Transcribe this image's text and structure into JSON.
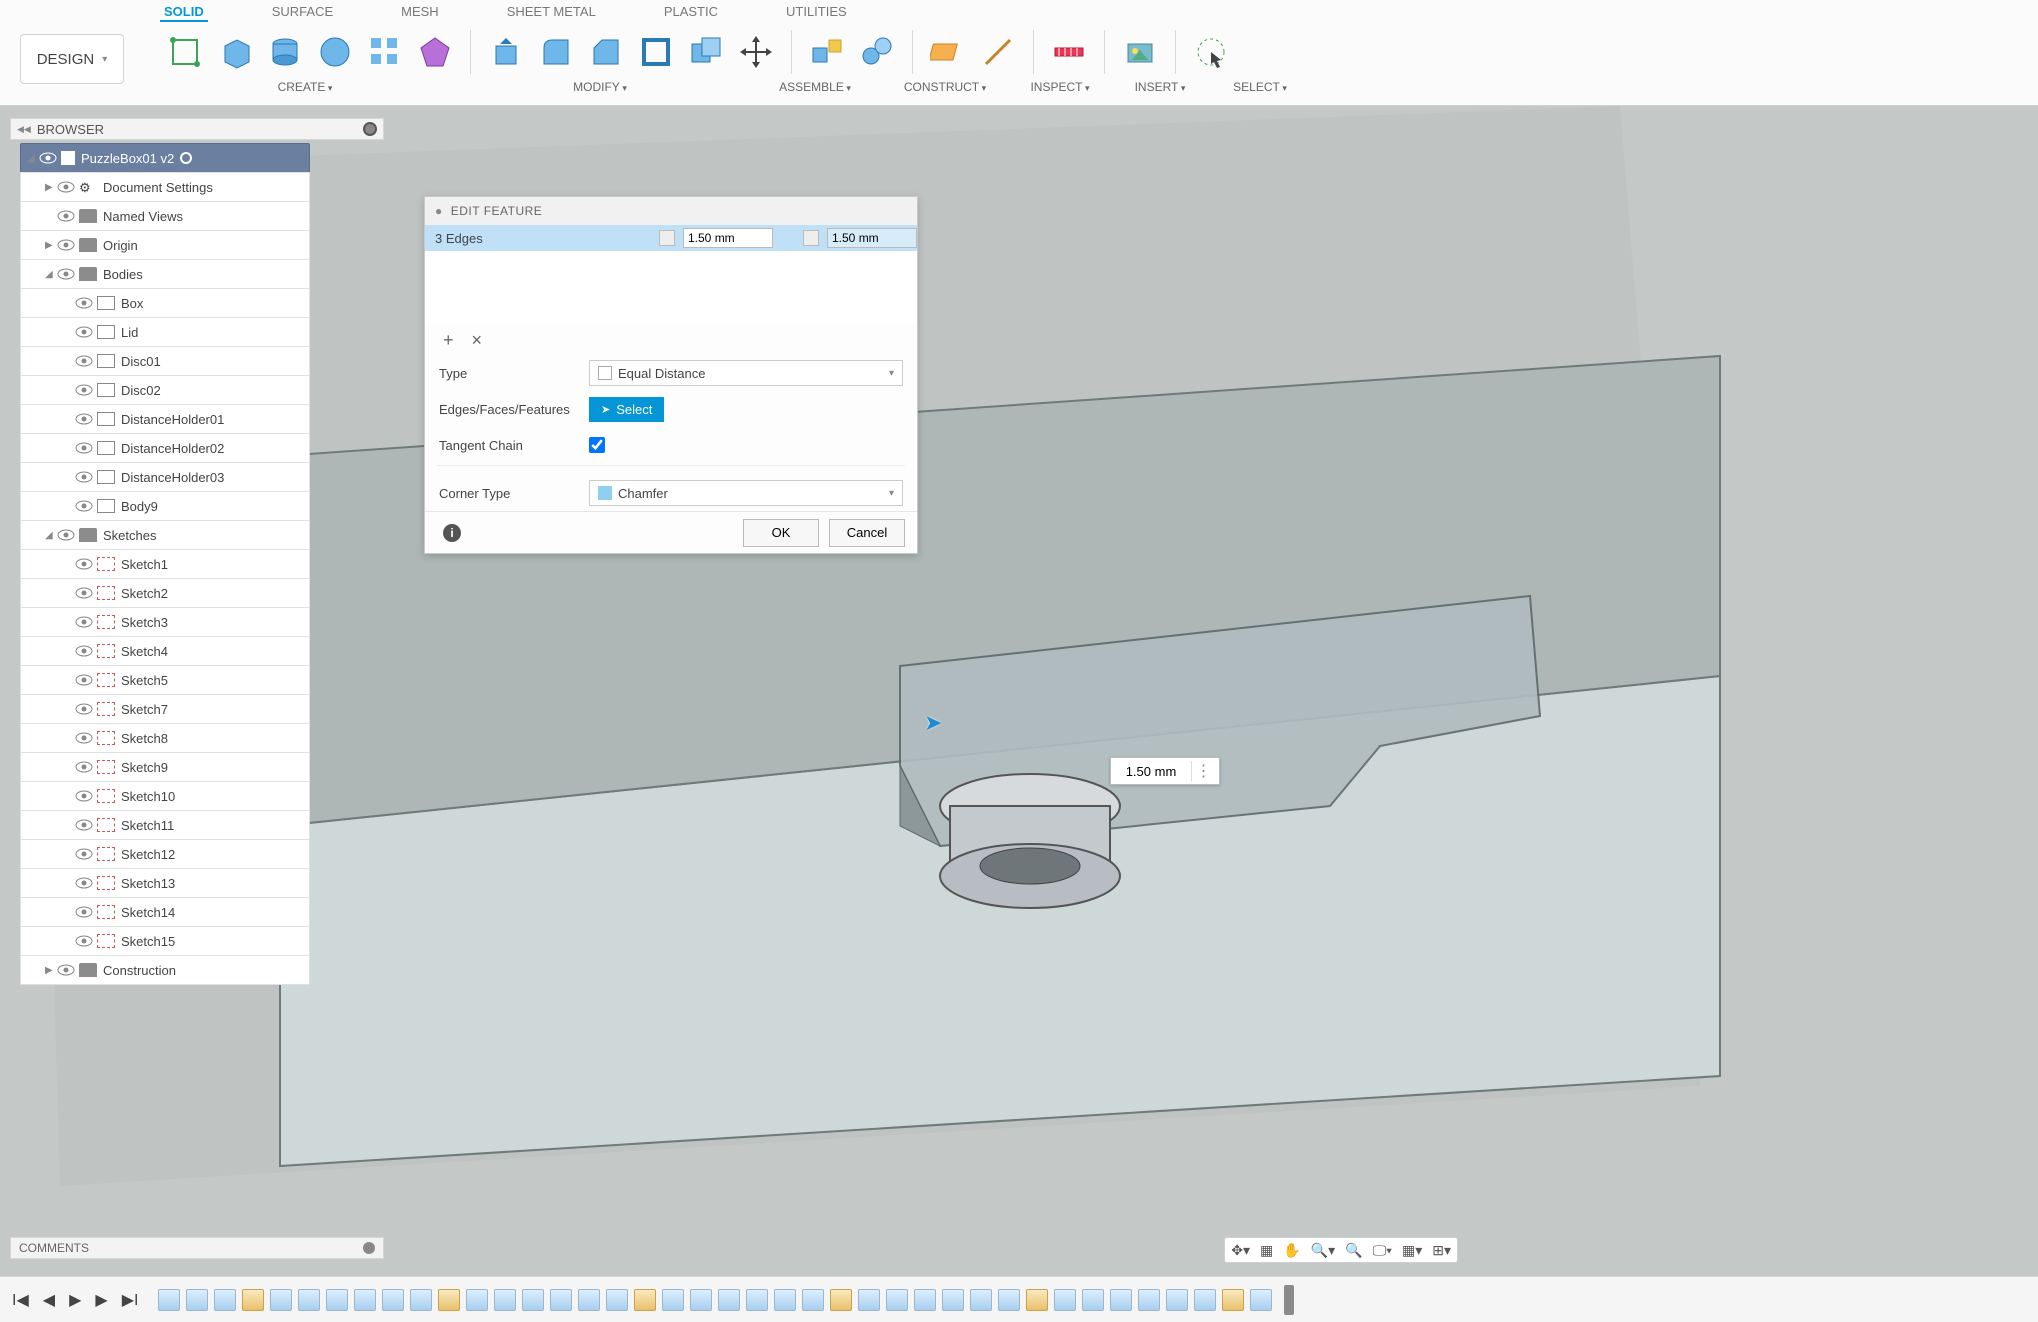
{
  "workspace": {
    "label": "DESIGN"
  },
  "tabs": [
    "SOLID",
    "SURFACE",
    "MESH",
    "SHEET METAL",
    "PLASTIC",
    "UTILITIES"
  ],
  "active_tab": "SOLID",
  "groups": {
    "create": "CREATE",
    "modify": "MODIFY",
    "assemble": "ASSEMBLE",
    "construct": "CONSTRUCT",
    "inspect": "INSPECT",
    "insert": "INSERT",
    "select": "SELECT"
  },
  "browser": {
    "title": "BROWSER",
    "root": "PuzzleBox01 v2",
    "items": [
      {
        "label": "Document Settings",
        "icon": "gear",
        "indent": 1,
        "tri": "▶"
      },
      {
        "label": "Named Views",
        "icon": "folder",
        "indent": 1,
        "tri": ""
      },
      {
        "label": "Origin",
        "icon": "folder",
        "indent": 1,
        "tri": "▶"
      },
      {
        "label": "Bodies",
        "icon": "folder",
        "indent": 1,
        "tri": "◢"
      },
      {
        "label": "Box",
        "icon": "body",
        "indent": 2
      },
      {
        "label": "Lid",
        "icon": "body",
        "indent": 2
      },
      {
        "label": "Disc01",
        "icon": "body",
        "indent": 2
      },
      {
        "label": "Disc02",
        "icon": "body",
        "indent": 2
      },
      {
        "label": "DistanceHolder01",
        "icon": "body",
        "indent": 2
      },
      {
        "label": "DistanceHolder02",
        "icon": "body",
        "indent": 2
      },
      {
        "label": "DistanceHolder03",
        "icon": "body",
        "indent": 2
      },
      {
        "label": "Body9",
        "icon": "body",
        "indent": 2
      },
      {
        "label": "Sketches",
        "icon": "folder",
        "indent": 1,
        "tri": "◢"
      },
      {
        "label": "Sketch1",
        "icon": "sketch",
        "indent": 2
      },
      {
        "label": "Sketch2",
        "icon": "sketch",
        "indent": 2
      },
      {
        "label": "Sketch3",
        "icon": "sketch",
        "indent": 2
      },
      {
        "label": "Sketch4",
        "icon": "sketch",
        "indent": 2
      },
      {
        "label": "Sketch5",
        "icon": "sketch",
        "indent": 2
      },
      {
        "label": "Sketch7",
        "icon": "sketch",
        "indent": 2
      },
      {
        "label": "Sketch8",
        "icon": "sketch",
        "indent": 2
      },
      {
        "label": "Sketch9",
        "icon": "sketch",
        "indent": 2
      },
      {
        "label": "Sketch10",
        "icon": "sketch",
        "indent": 2
      },
      {
        "label": "Sketch11",
        "icon": "sketch",
        "indent": 2
      },
      {
        "label": "Sketch12",
        "icon": "sketch",
        "indent": 2
      },
      {
        "label": "Sketch13",
        "icon": "sketch",
        "indent": 2
      },
      {
        "label": "Sketch14",
        "icon": "sketch",
        "indent": 2
      },
      {
        "label": "Sketch15",
        "icon": "sketch",
        "indent": 2
      },
      {
        "label": "Construction",
        "icon": "folder",
        "indent": 1,
        "tri": "▶"
      }
    ]
  },
  "dialog": {
    "title": "EDIT FEATURE",
    "selection_label": "3 Edges",
    "dist1": "1.50 mm",
    "dist2": "1.50 mm",
    "type_label": "Type",
    "type_value": "Equal Distance",
    "edges_label": "Edges/Faces/Features",
    "select_btn": "Select",
    "tangent_label": "Tangent Chain",
    "tangent_checked": true,
    "corner_label": "Corner Type",
    "corner_value": "Chamfer",
    "ok": "OK",
    "cancel": "Cancel"
  },
  "viewport_input": "1.50 mm",
  "comments": "COMMENTS",
  "timeline_steps": 40
}
